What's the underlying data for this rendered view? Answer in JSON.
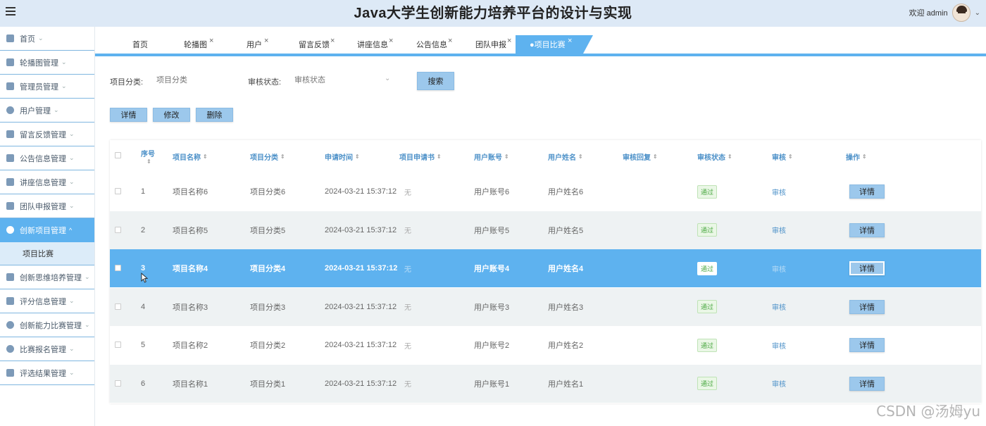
{
  "header": {
    "title": "Java大学生创新能力培养平台的设计与实现",
    "welcome": "欢迎 admin",
    "dropdown": "⌄"
  },
  "sidebar": {
    "items": [
      {
        "label": "首页",
        "icon": "home-icon"
      },
      {
        "label": "轮播图管理",
        "icon": "image-icon"
      },
      {
        "label": "管理员管理",
        "icon": "grid-icon"
      },
      {
        "label": "用户管理",
        "icon": "user-icon"
      },
      {
        "label": "留言反馈管理",
        "icon": "message-icon"
      },
      {
        "label": "公告信息管理",
        "icon": "cart-icon"
      },
      {
        "label": "讲座信息管理",
        "icon": "monitor-icon"
      },
      {
        "label": "团队申报管理",
        "icon": "grid-icon"
      },
      {
        "label": "创新项目管理",
        "icon": "clock-icon"
      },
      {
        "label": "创新思维培养管理",
        "icon": "mail-icon"
      },
      {
        "label": "评分信息管理",
        "icon": "grid-icon"
      },
      {
        "label": "创新能力比赛管理",
        "icon": "check-circle-icon"
      },
      {
        "label": "比赛报名管理",
        "icon": "drop-icon"
      },
      {
        "label": "评选结果管理",
        "icon": "table-icon"
      }
    ],
    "sub_item": "项目比赛",
    "arrow_down": "⌄",
    "arrow_up": "^"
  },
  "tabs": [
    {
      "label": "首页"
    },
    {
      "label": "轮播图"
    },
    {
      "label": "用户"
    },
    {
      "label": "留言反馈"
    },
    {
      "label": "讲座信息"
    },
    {
      "label": "公告信息"
    },
    {
      "label": "团队申报"
    },
    {
      "label": "●项目比赛"
    }
  ],
  "tab_close": "×",
  "search": {
    "category_label": "项目分类:",
    "category_placeholder": "项目分类",
    "status_label": "审核状态:",
    "status_placeholder": "审核状态",
    "select_arrow": "⌄",
    "search_button": "搜索"
  },
  "actions": {
    "detail": "详情",
    "edit": "修改",
    "delete": "删除"
  },
  "table": {
    "columns": [
      "序号",
      "项目名称",
      "项目分类",
      "申请时间",
      "项目申请书",
      "用户账号",
      "用户姓名",
      "审核回复",
      "审核状态",
      "审核",
      "操作"
    ],
    "sort_glyph": "⇕",
    "rows": [
      {
        "no": "1",
        "name": "项目名称6",
        "category": "项目分类6",
        "time": "2024-03-21 15:37:12",
        "doc": "无",
        "account": "用户账号6",
        "username": "用户姓名6",
        "status": "通过",
        "audit": "审核",
        "op": "详情"
      },
      {
        "no": "2",
        "name": "项目名称5",
        "category": "项目分类5",
        "time": "2024-03-21 15:37:12",
        "doc": "无",
        "account": "用户账号5",
        "username": "用户姓名5",
        "status": "通过",
        "audit": "审核",
        "op": "详情"
      },
      {
        "no": "3",
        "name": "项目名称4",
        "category": "项目分类4",
        "time": "2024-03-21 15:37:12",
        "doc": "无",
        "account": "用户账号4",
        "username": "用户姓名4",
        "status": "通过",
        "audit": "审核",
        "op": "详情"
      },
      {
        "no": "4",
        "name": "项目名称3",
        "category": "项目分类3",
        "time": "2024-03-21 15:37:12",
        "doc": "无",
        "account": "用户账号3",
        "username": "用户姓名3",
        "status": "通过",
        "audit": "审核",
        "op": "详情"
      },
      {
        "no": "5",
        "name": "项目名称2",
        "category": "项目分类2",
        "time": "2024-03-21 15:37:12",
        "doc": "无",
        "account": "用户账号2",
        "username": "用户姓名2",
        "status": "通过",
        "audit": "审核",
        "op": "详情"
      },
      {
        "no": "6",
        "name": "项目名称1",
        "category": "项目分类1",
        "time": "2024-03-21 15:37:12",
        "doc": "无",
        "account": "用户账号1",
        "username": "用户姓名1",
        "status": "通过",
        "audit": "审核",
        "op": "详情"
      }
    ]
  },
  "watermark": "CSDN @汤姆yu",
  "colors": {
    "accent": "#5eb2ef",
    "header_bg": "#dde9f6",
    "button": "#9cc8ec",
    "success": "#4aa842"
  }
}
